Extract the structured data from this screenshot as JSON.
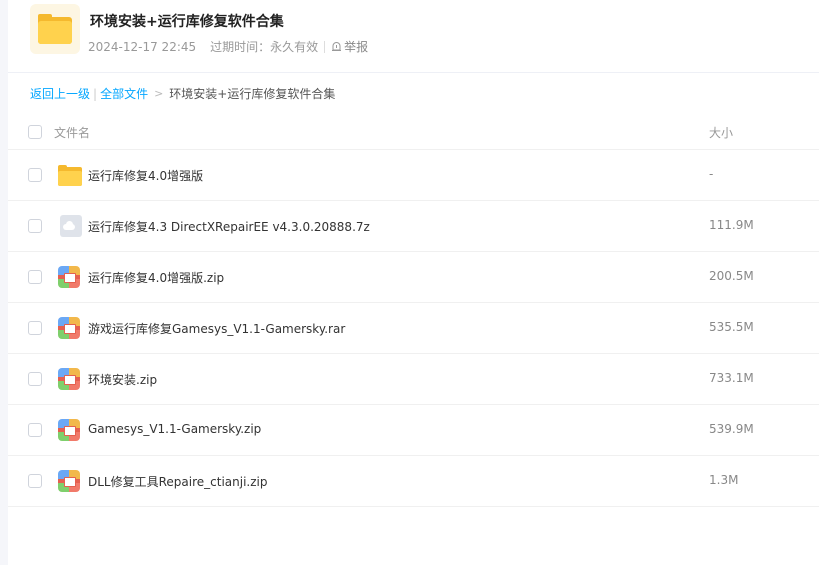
{
  "header": {
    "title": "环境安装+运行库修复软件合集",
    "date": "2024-12-17 22:45",
    "expire_label": "过期时间：永久有效",
    "report_label": "举报"
  },
  "breadcrumb": {
    "back": "返回上一级",
    "separator": "|",
    "all_files": "全部文件",
    "arrow": ">",
    "current": "环境安装+运行库修复软件合集"
  },
  "columns": {
    "name": "文件名",
    "size": "大小"
  },
  "files": [
    {
      "name": "运行库修复4.0增强版",
      "size": "-",
      "icon": "folder-icon"
    },
    {
      "name": "运行库修复4.3 DirectXRepairEE v4.3.0.20888.7z",
      "size": "111.9M",
      "icon": "cloud-file-icon"
    },
    {
      "name": "运行库修复4.0增强版.zip",
      "size": "200.5M",
      "icon": "zip-icon"
    },
    {
      "name": "游戏运行库修复Gamesys_V1.1-Gamersky.rar",
      "size": "535.5M",
      "icon": "zip-icon"
    },
    {
      "name": "环境安装.zip",
      "size": "733.1M",
      "icon": "zip-icon"
    },
    {
      "name": "Gamesys_V1.1-Gamersky.zip",
      "size": "539.9M",
      "icon": "zip-icon"
    },
    {
      "name": "DLL修复工具Repaire_ctianji.zip",
      "size": "1.3M",
      "icon": "zip-icon"
    }
  ],
  "colors": {
    "link": "#06a7ff",
    "folder": "#ffd24d",
    "background": "#f5f6fa"
  }
}
